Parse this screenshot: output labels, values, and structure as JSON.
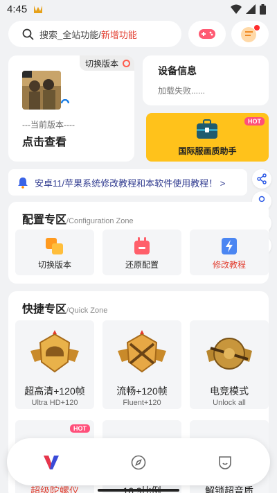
{
  "status_bar": {
    "time": "4:45"
  },
  "search": {
    "placeholder": "搜索_全站功能/",
    "highlight": "新增功能"
  },
  "version_card": {
    "switch_label": "切换版本",
    "current_label": "---当前版本----",
    "view_label": "点击查看"
  },
  "device_card": {
    "title": "设备信息",
    "status": "加载失败......"
  },
  "intl_card": {
    "badge": "HOT",
    "label": "国际服画质助手"
  },
  "notice": {
    "text": "安卓11/苹果系统修改教程和本软件使用教程！ >"
  },
  "config": {
    "title": "配置专区",
    "subtitle": "/Configuration Zone",
    "items": [
      {
        "label": "切换版本",
        "icon": "switch-version-icon"
      },
      {
        "label": "还原配置",
        "icon": "restore-config-icon"
      },
      {
        "label": "修改教程",
        "icon": "tutorial-icon",
        "highlight": true
      }
    ]
  },
  "quick": {
    "title": "快捷专区",
    "subtitle": "/Quick Zone",
    "items": [
      {
        "title": "超高清+120帧",
        "sub": "Ultra HD+120"
      },
      {
        "title": "流畅+120帧",
        "sub": "Fluent+120"
      },
      {
        "title": "电竞模式",
        "sub": "Unlock all"
      },
      {
        "title": "超级陀螺仪",
        "badge": "HOT",
        "highlight": true
      },
      {
        "title": "16:9比例"
      },
      {
        "title": "解锁超音质"
      }
    ]
  },
  "colors": {
    "accent_red": "#e24032",
    "hot_pink": "#ff4f7a",
    "yellow_card": "#ffc21b",
    "notice_blue": "#2f3a8f"
  }
}
